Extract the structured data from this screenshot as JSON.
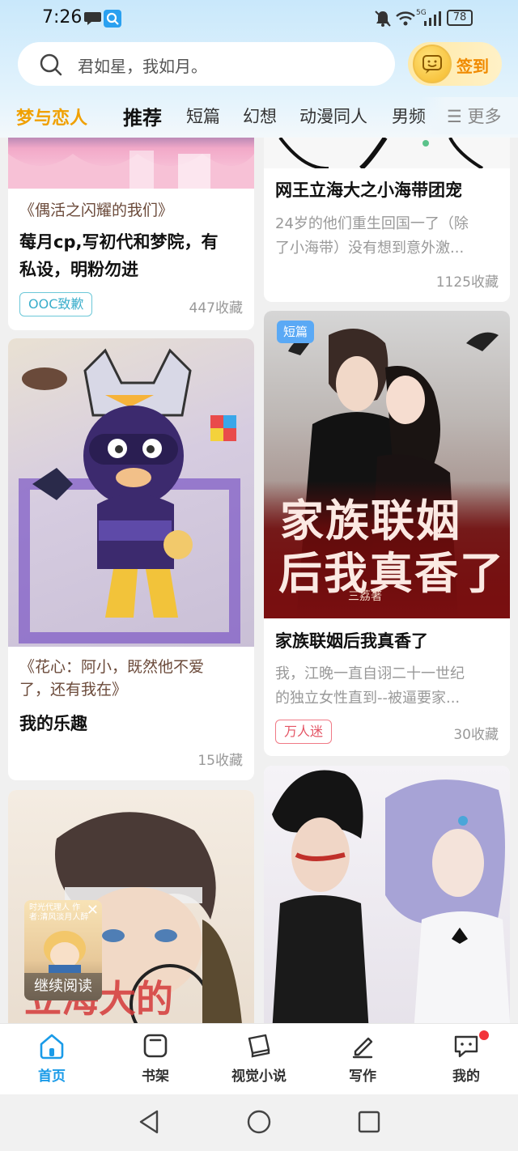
{
  "status_bar": {
    "time": "7:26",
    "battery": "78",
    "network": "5G"
  },
  "search": {
    "placeholder": "君如星，我如月。"
  },
  "signin": {
    "label": "签到"
  },
  "tabs": [
    "梦与恋人",
    "推荐",
    "短篇",
    "幻想",
    "动漫同人",
    "男频"
  ],
  "more_label": "☰ 更多",
  "cards": {
    "c1": {
      "quote": "《偶活之闪耀的我们》",
      "title_line1": "莓月cp,写初代和梦院，有",
      "title_line2": "私设，明粉勿进",
      "tag": "OOC致歉",
      "favs": "447收藏"
    },
    "c2": {
      "title": "网王立海大之小海带团宠",
      "desc_line1": "24岁的他们重生回国一了（除",
      "desc_line2": "了小海带）没有想到意外激...",
      "favs": "1125收藏"
    },
    "c3": {
      "quote_line1": "《花心：阿小，既然他不爱",
      "quote_line2": "了，还有我在》",
      "title": "我的乐趣",
      "favs": "15收藏"
    },
    "c4": {
      "badge": "短篇",
      "cover_title_line1": "家族联姻",
      "cover_title_line2": "后我真香了",
      "cover_author": "三荔著",
      "title": "家族联姻后我真香了",
      "desc_line1": "我，江晚一直自诩二十一世纪",
      "desc_line2": "的独立女性直到--被逼要家...",
      "tag": "万人迷",
      "favs": "30收藏"
    },
    "c5": {
      "cover_text": "立海大的"
    }
  },
  "continue_reading": {
    "label": "继续阅读",
    "cover_text": "时光代理人 作者:清风淡月人醉"
  },
  "bottom_nav": [
    {
      "label": "首页",
      "icon": "home-icon",
      "active": true
    },
    {
      "label": "书架",
      "icon": "bookshelf-icon",
      "active": false
    },
    {
      "label": "视觉小说",
      "icon": "book-icon",
      "active": false
    },
    {
      "label": "写作",
      "icon": "pencil-icon",
      "active": false
    },
    {
      "label": "我的",
      "icon": "chat-bubble-icon",
      "active": false
    }
  ],
  "colors": {
    "accent": "#1a9be8",
    "brand_tab": "#f0a000",
    "signin": "#f08a00",
    "tag_ooc": "#3aaecb",
    "tag_wanren": "#e45565"
  }
}
